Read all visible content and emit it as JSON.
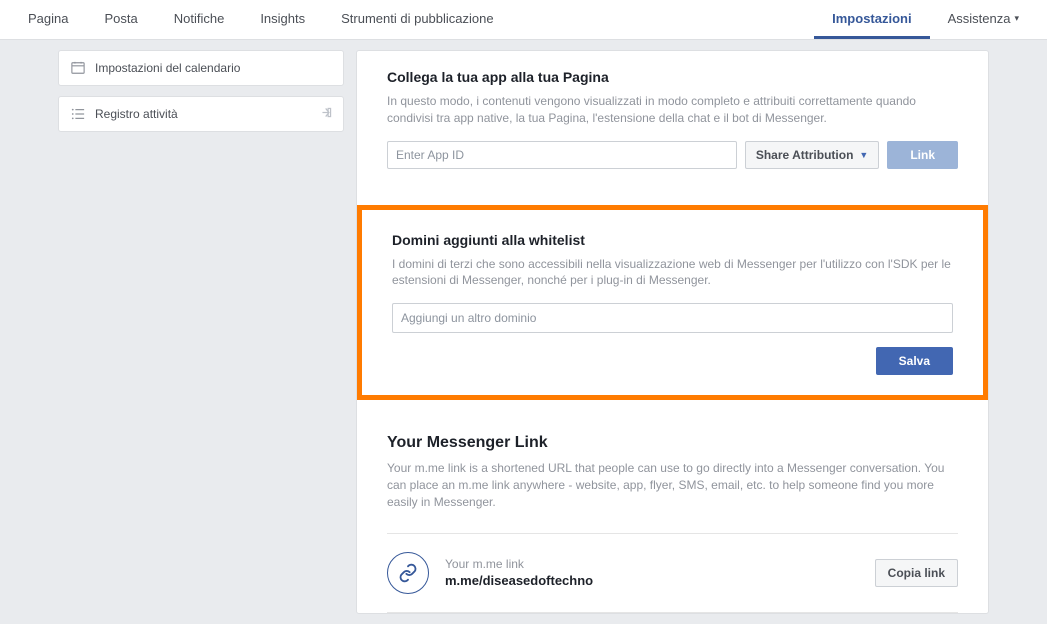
{
  "nav": {
    "left": [
      "Pagina",
      "Posta",
      "Notifiche",
      "Insights",
      "Strumenti di pubblicazione"
    ],
    "right": [
      "Impostazioni",
      "Assistenza"
    ],
    "active": "Impostazioni"
  },
  "sidebar": {
    "items": [
      {
        "label": "Impostazioni del calendario"
      },
      {
        "label": "Registro attività"
      }
    ]
  },
  "linkApp": {
    "title": "Collega la tua app alla tua Pagina",
    "desc": "In questo modo, i contenuti vengono visualizzati in modo completo e attribuiti correttamente quando condivisi tra app native, la tua Pagina, l'estensione della chat e il bot di Messenger.",
    "placeholder": "Enter App ID",
    "shareLabel": "Share Attribution",
    "linkBtn": "Link"
  },
  "whitelist": {
    "title": "Domini aggiunti alla whitelist",
    "desc": "I domini di terzi che sono accessibili nella visualizzazione web di Messenger per l'utilizzo con l'SDK per le estensioni di Messenger, nonché per i plug-in di Messenger.",
    "placeholder": "Aggiungi un altro dominio",
    "saveBtn": "Salva"
  },
  "messengerLink": {
    "title": "Your Messenger Link",
    "desc": "Your m.me link is a shortened URL that people can use to go directly into a Messenger conversation. You can place an m.me link anywhere - website, app, flyer, SMS, email, etc. to help someone find you more easily in Messenger.",
    "label": "Your m.me link",
    "url": "m.me/diseasedoftechno",
    "copyBtn": "Copia link"
  }
}
